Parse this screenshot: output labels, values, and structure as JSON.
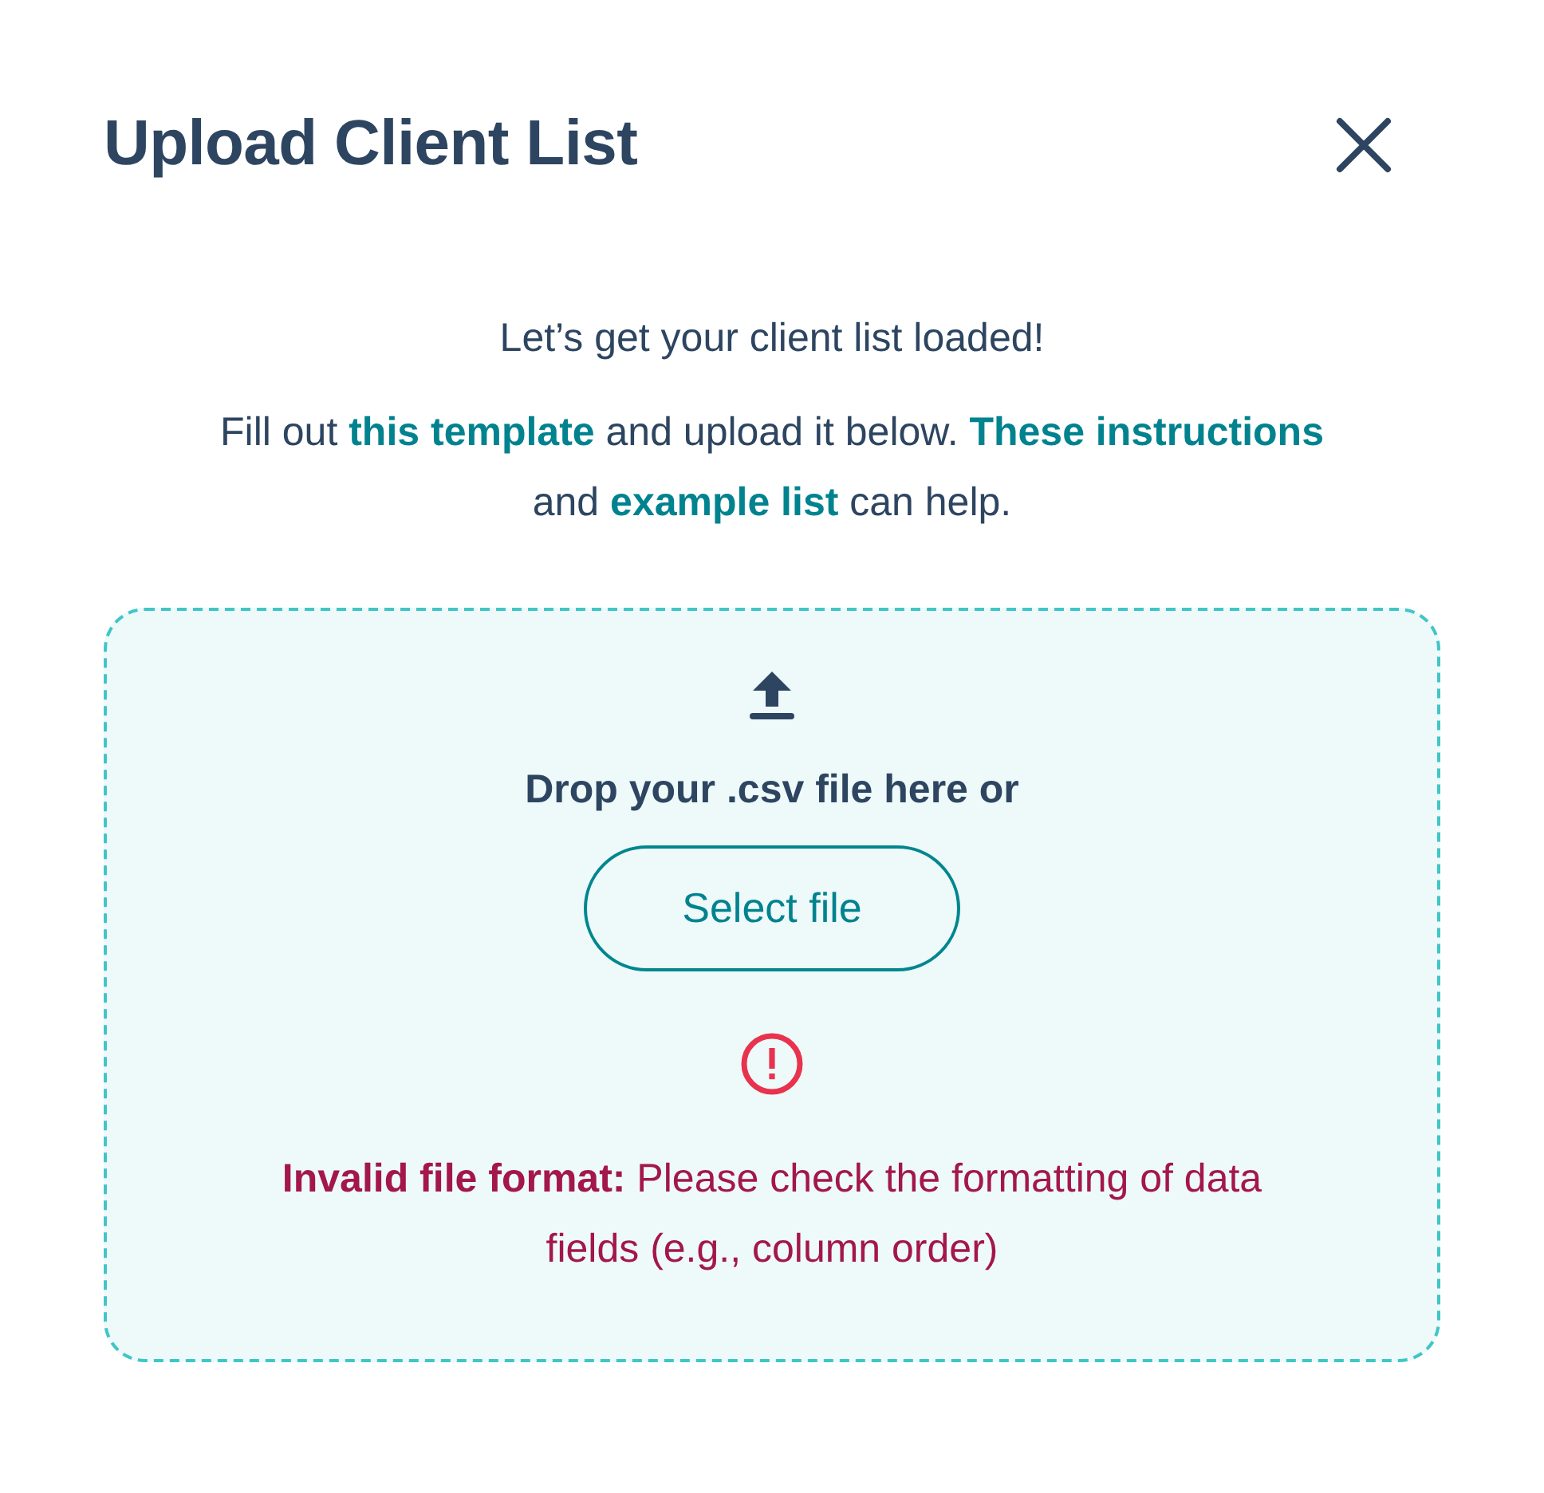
{
  "dialog": {
    "title": "Upload Client List"
  },
  "intro": {
    "heading": "Let’s get your client list loaded!",
    "paragraph": [
      {
        "kind": "text",
        "text": "Fill out "
      },
      {
        "kind": "link",
        "text": "this template"
      },
      {
        "kind": "text",
        "text": " and upload it below. "
      },
      {
        "kind": "link",
        "text": "These instructions"
      },
      {
        "kind": "text",
        "text": " and "
      },
      {
        "kind": "link",
        "text": "example list"
      },
      {
        "kind": "text",
        "text": " can help."
      }
    ]
  },
  "dropzone": {
    "prompt": "Drop your .csv file here or",
    "button": "Select file",
    "error": {
      "message": "**Invalid file format:** Please check the formatting of data fields (e.g., column order)"
    }
  }
}
